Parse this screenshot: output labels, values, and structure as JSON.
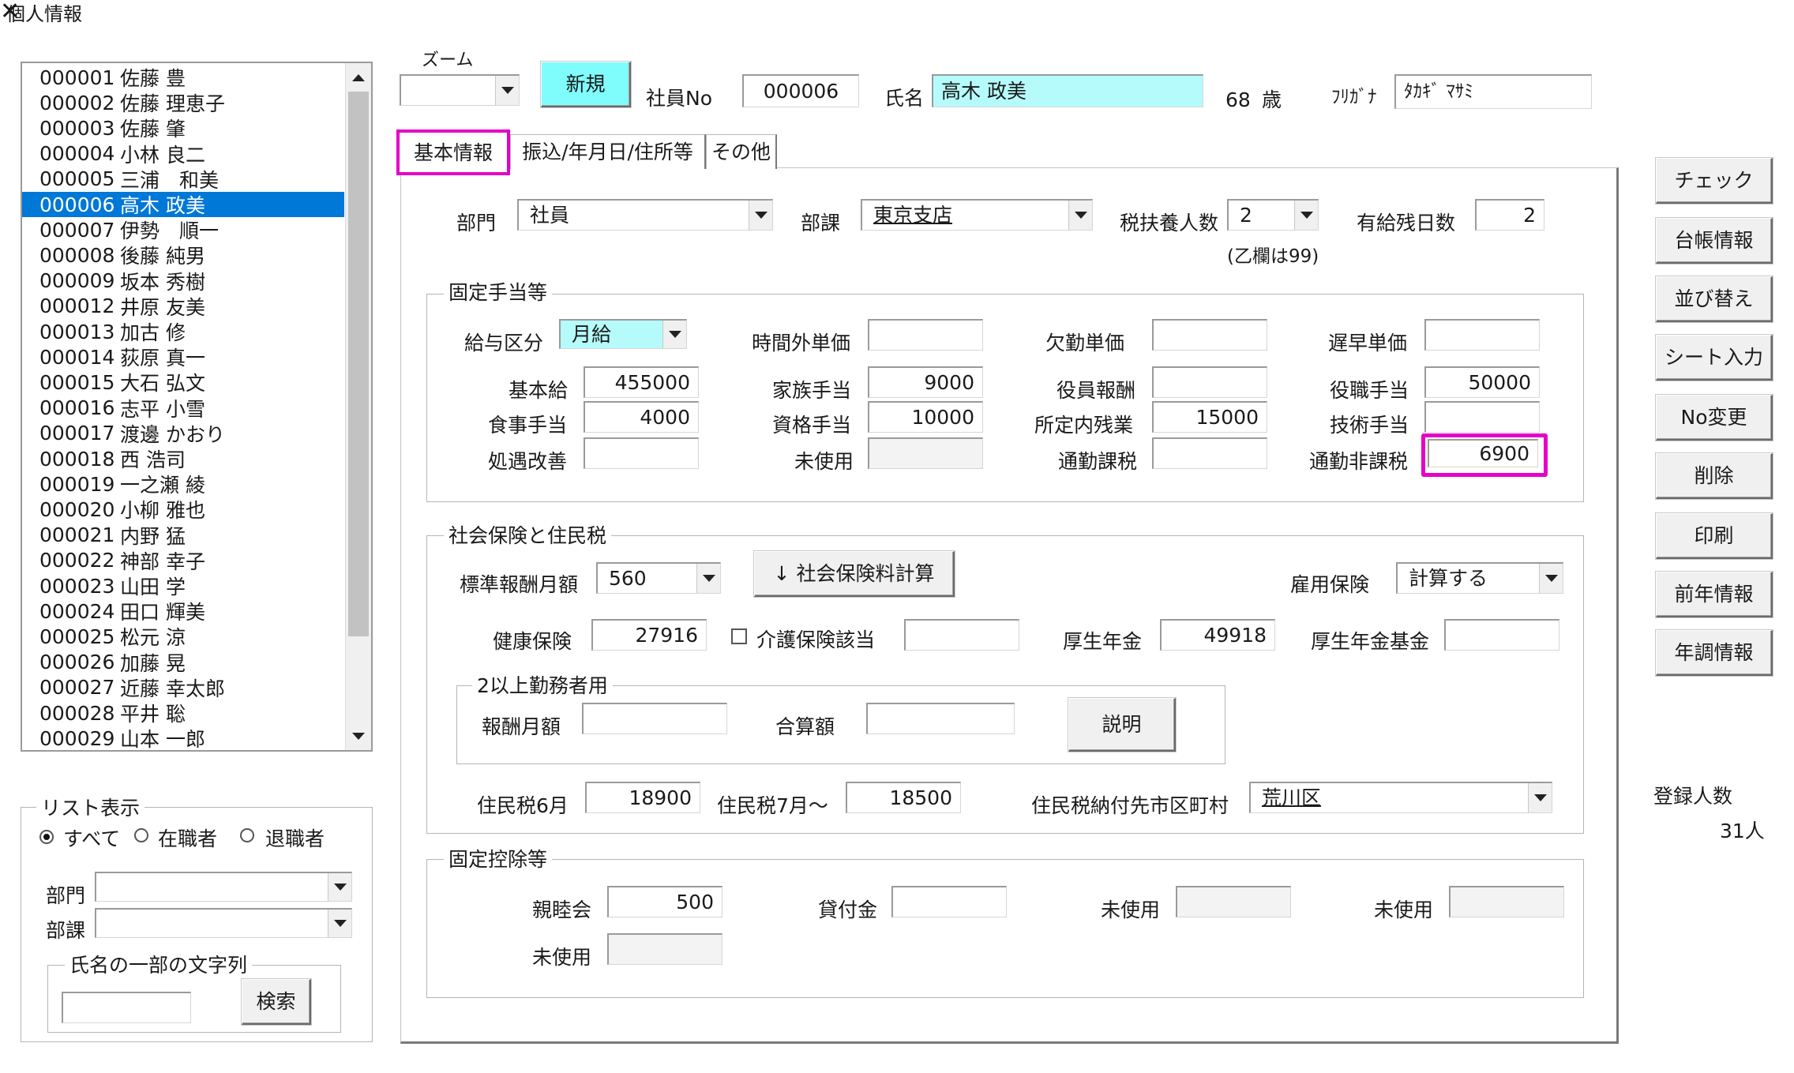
{
  "window": {
    "title": "個人情報",
    "close": "✕"
  },
  "employees": [
    {
      "no": "000001",
      "name": "佐藤 豊"
    },
    {
      "no": "000002",
      "name": "佐藤 理恵子"
    },
    {
      "no": "000003",
      "name": "佐藤 肇"
    },
    {
      "no": "000004",
      "name": "小林 良二"
    },
    {
      "no": "000005",
      "name": "三浦　和美"
    },
    {
      "no": "000006",
      "name": "高木 政美",
      "selected": true
    },
    {
      "no": "000007",
      "name": "伊勢　順一"
    },
    {
      "no": "000008",
      "name": "後藤 純男"
    },
    {
      "no": "000009",
      "name": "坂本 秀樹"
    },
    {
      "no": "000012",
      "name": "井原 友美"
    },
    {
      "no": "000013",
      "name": "加古 修"
    },
    {
      "no": "000014",
      "name": "荻原 真一"
    },
    {
      "no": "000015",
      "name": "大石 弘文"
    },
    {
      "no": "000016",
      "name": "志平 小雪"
    },
    {
      "no": "000017",
      "name": "渡邊 かおり"
    },
    {
      "no": "000018",
      "name": "西 浩司"
    },
    {
      "no": "000019",
      "name": "一之瀬 綾"
    },
    {
      "no": "000020",
      "name": "小柳 雅也"
    },
    {
      "no": "000021",
      "name": "内野 猛"
    },
    {
      "no": "000022",
      "name": "神部 幸子"
    },
    {
      "no": "000023",
      "name": "山田 学"
    },
    {
      "no": "000024",
      "name": "田口 輝美"
    },
    {
      "no": "000025",
      "name": "松元 涼"
    },
    {
      "no": "000026",
      "name": "加藤 晃"
    },
    {
      "no": "000027",
      "name": "近藤 幸太郎"
    },
    {
      "no": "000028",
      "name": "平井 聡"
    },
    {
      "no": "000029",
      "name": "山本 一郎"
    }
  ],
  "list_filter": {
    "title": "リスト表示",
    "radio_all": "すべて",
    "radio_active": "在職者",
    "radio_retired": "退職者",
    "selected": "all",
    "dept_label": "部門",
    "section_label": "部課",
    "name_group": "氏名の一部の文字列",
    "search_button": "検索"
  },
  "header": {
    "zoom_label": "ズーム",
    "new_button": "新規",
    "emp_no_label": "社員No",
    "emp_no": "000006",
    "name_label": "氏名",
    "name": "高木 政美",
    "age": "68",
    "age_unit": "歳",
    "kana_label": "ﾌﾘｶﾞﾅ",
    "kana": "ﾀｶｷﾞ ﾏｻﾐ"
  },
  "tabs": [
    "基本情報",
    "振込/年月日/住所等",
    "その他"
  ],
  "basic": {
    "dept_label": "部門",
    "dept": "社員",
    "section_label": "部課",
    "section": "東京支店",
    "dependents_label": "税扶養人数",
    "dependents": "2",
    "dependents_note": "(乙欄は99)",
    "paid_leave_label": "有給残日数",
    "paid_leave": "2"
  },
  "allowances": {
    "title": "固定手当等",
    "pay_type_label": "給与区分",
    "pay_type": "月給",
    "overtime_label": "時間外単価",
    "overtime": "",
    "absence_label": "欠勤単価",
    "absence": "",
    "late_label": "遅早単価",
    "late": "",
    "base_label": "基本給",
    "base": "455000",
    "family_label": "家族手当",
    "family": "9000",
    "officer_label": "役員報酬",
    "officer": "",
    "position_label": "役職手当",
    "position": "50000",
    "meal_label": "食事手当",
    "meal": "4000",
    "qualification_label": "資格手当",
    "qualification": "10000",
    "scheduled_ot_label": "所定内残業",
    "scheduled_ot": "15000",
    "skill_label": "技術手当",
    "skill": "",
    "improvement_label": "処遇改善",
    "improvement": "",
    "unused_label": "未使用",
    "unused": "",
    "commute_taxable_label": "通勤課税",
    "commute_taxable": "",
    "commute_nontaxable_label": "通勤非課税",
    "commute_nontaxable": "6900"
  },
  "insurance": {
    "title": "社会保険と住民税",
    "std_label": "標準報酬月額",
    "std": "560",
    "calc_button": "↓ 社会保険料計算",
    "employment_label": "雇用保険",
    "employment": "計算する",
    "health_label": "健康保険",
    "health": "27916",
    "care_label": "介護保険該当",
    "care": "",
    "pension_label": "厚生年金",
    "pension": "49918",
    "pension_fund_label": "厚生年金基金",
    "pension_fund": "",
    "multi_title": "2以上勤務者用",
    "multi_monthly_label": "報酬月額",
    "multi_monthly": "",
    "multi_total_label": "合算額",
    "multi_total": "",
    "explain_button": "説明",
    "res_june_label": "住民税6月",
    "res_june": "18900",
    "res_july_label": "住民税7月～",
    "res_july": "18500",
    "res_city_label": "住民税納付先市区町村",
    "res_city": "荒川区"
  },
  "deductions": {
    "title": "固定控除等",
    "social_label": "親睦会",
    "social": "500",
    "loan_label": "貸付金",
    "loan": "",
    "unused1_label": "未使用",
    "unused1": "",
    "unused2_label": "未使用",
    "unused2": "",
    "unused3_label": "未使用",
    "unused3": ""
  },
  "side_buttons": [
    "チェック",
    "台帳情報",
    "並び替え",
    "シート入力",
    "No変更",
    "削除",
    "印刷",
    "前年情報",
    "年調情報"
  ],
  "registered": {
    "label": "登録人数",
    "count": "31人"
  },
  "colors": {
    "selection": "#0078d7",
    "highlight": "#e600c8",
    "name_field": "#b6fbfb",
    "new_button": "#7ffcfc"
  }
}
